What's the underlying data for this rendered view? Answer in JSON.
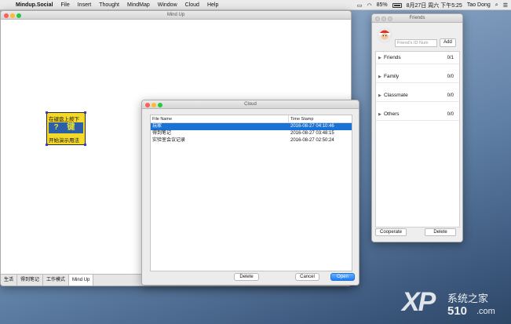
{
  "menubar": {
    "app_name": "Mindup.Social",
    "items": [
      "File",
      "Insert",
      "Thought",
      "MindMap",
      "Window",
      "Cloud",
      "Help"
    ],
    "battery": "85%",
    "datetime": "8月27日 周六 下午5:25",
    "user": "Tao Dong"
  },
  "mindup_window": {
    "title": "Mind Up",
    "node": {
      "line1": "在键盘上按下",
      "key": "? 键",
      "line2": "开始演示用法"
    },
    "tabs": [
      "生活",
      "得到笔记",
      "工作模式",
      "Mind Up"
    ]
  },
  "cloud_dialog": {
    "title": "Cloud",
    "columns": [
      "File Name",
      "Time Stamp"
    ],
    "rows": [
      {
        "name": "玩家",
        "time": "2016-08-27 04:10:46",
        "selected": true
      },
      {
        "name": "得到笔记",
        "time": "2016-08-27 03:48:15",
        "selected": false
      },
      {
        "name": "实验室会议记录",
        "time": "2016-08-27 02:50:24",
        "selected": false
      }
    ],
    "delete_label": "Delete",
    "cancel_label": "Cancel",
    "open_label": "Open"
  },
  "friends_window": {
    "title": "Friends",
    "search_placeholder": "Friend's ID Num",
    "add_label": "Add",
    "groups": [
      {
        "name": "Friends",
        "count": "0/1"
      },
      {
        "name": "Family",
        "count": "0/0"
      },
      {
        "name": "Classmate",
        "count": "0/0"
      },
      {
        "name": "Others",
        "count": "0/0"
      }
    ],
    "cooperate_label": "Cooperate",
    "delete_label": "Delete"
  },
  "watermark": {
    "xp": "XP",
    "cn": "系统之家",
    "num": "510",
    "dom": ".com"
  },
  "colors": {
    "accent": "#1a72d6",
    "node_fill": "#f5d92a",
    "node_key_bg": "#2d5fa8"
  }
}
